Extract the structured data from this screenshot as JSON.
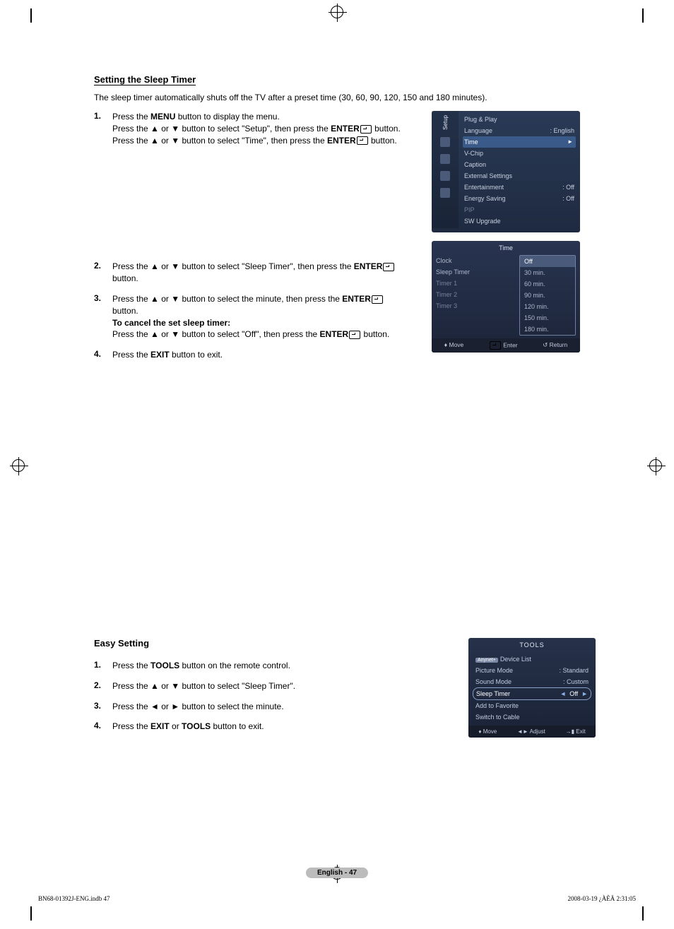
{
  "section1": {
    "title": "Setting the Sleep Timer",
    "intro": "The sleep timer automatically shuts off the TV after a preset time (30, 60, 90, 120, 150 and 180 minutes).",
    "steps": {
      "s1a": "Press the ",
      "s1b": "MENU",
      "s1c": " button to display the menu.",
      "s1d": "Press the ▲ or ▼ button to select \"Setup\", then press the ",
      "s1e": "ENTER",
      "s1f": " button.",
      "s1g": "Press the ▲ or ▼ button to select \"Time\", then press the ",
      "s1h": "ENTER",
      "s1i": " button.",
      "s2a": "Press the ▲ or ▼ button to select \"Sleep Timer\", then press the ",
      "s2b": "ENTER",
      "s2c": "button.",
      "s3a": "Press the ▲ or ▼ button to select the minute, then press the ",
      "s3b": "ENTER",
      "s3c": "button.",
      "s3d": "To cancel the set sleep timer:",
      "s3e": "Press the ▲ or ▼ button to select \"Off\", then press the ",
      "s3f": "ENTER",
      "s3g": " button.",
      "s4a": "Press the ",
      "s4b": "EXIT",
      "s4c": " button to exit."
    },
    "nums": {
      "n1": "1.",
      "n2": "2.",
      "n3": "3.",
      "n4": "4."
    }
  },
  "osd_setup": {
    "tab": "Setup",
    "items": [
      {
        "label": "Plug & Play",
        "value": ""
      },
      {
        "label": "Language",
        "value": "English"
      },
      {
        "label": "Time",
        "value": "",
        "selected": true
      },
      {
        "label": "V-Chip",
        "value": ""
      },
      {
        "label": "Caption",
        "value": ""
      },
      {
        "label": "External Settings",
        "value": ""
      },
      {
        "label": "Entertainment",
        "value": "Off"
      },
      {
        "label": "Energy Saving",
        "value": "Off"
      },
      {
        "label": "PIP",
        "value": "",
        "dim": true
      },
      {
        "label": "SW Upgrade",
        "value": ""
      }
    ]
  },
  "osd_time": {
    "title": "Time",
    "left": [
      "Clock",
      "Sleep Timer",
      "Timer 1",
      "Timer 2",
      "Timer 3"
    ],
    "options": [
      "Off",
      "30 min.",
      "60 min.",
      "90 min.",
      "120 min.",
      "150 min.",
      "180 min."
    ],
    "footer": {
      "move": "Move",
      "enter": "Enter",
      "return": "Return"
    }
  },
  "section2": {
    "title": "Easy Setting",
    "nums": {
      "n1": "1.",
      "n2": "2.",
      "n3": "3.",
      "n4": "4."
    },
    "s1a": "Press the ",
    "s1b": "TOOLS",
    "s1c": " button on the remote control.",
    "s2": "Press the ▲ or ▼ button to select \"Sleep Timer\".",
    "s3": "Press the ◄ or ► button to select the minute.",
    "s4a": "Press the ",
    "s4b": "EXIT",
    "s4c": " or ",
    "s4d": "TOOLS",
    "s4e": " button to exit."
  },
  "osd_tools": {
    "title": "TOOLS",
    "rows": [
      {
        "label": "Device List",
        "badge": "Anynet+"
      },
      {
        "label": "Picture Mode",
        "value": "Standard"
      },
      {
        "label": "Sound Mode",
        "value": "Custom"
      },
      {
        "label": "Sleep Timer",
        "value": "Off",
        "selected": true
      },
      {
        "label": "Add to Favorite"
      },
      {
        "label": "Switch to Cable"
      }
    ],
    "footer": {
      "move": "Move",
      "adjust": "Adjust",
      "exit": "Exit"
    }
  },
  "page_badge": "English - 47",
  "footer": {
    "left": "BN68-01392J-ENG.indb   47",
    "right": "2008-03-19   ¿ÀÈÄ 2:31:05"
  }
}
